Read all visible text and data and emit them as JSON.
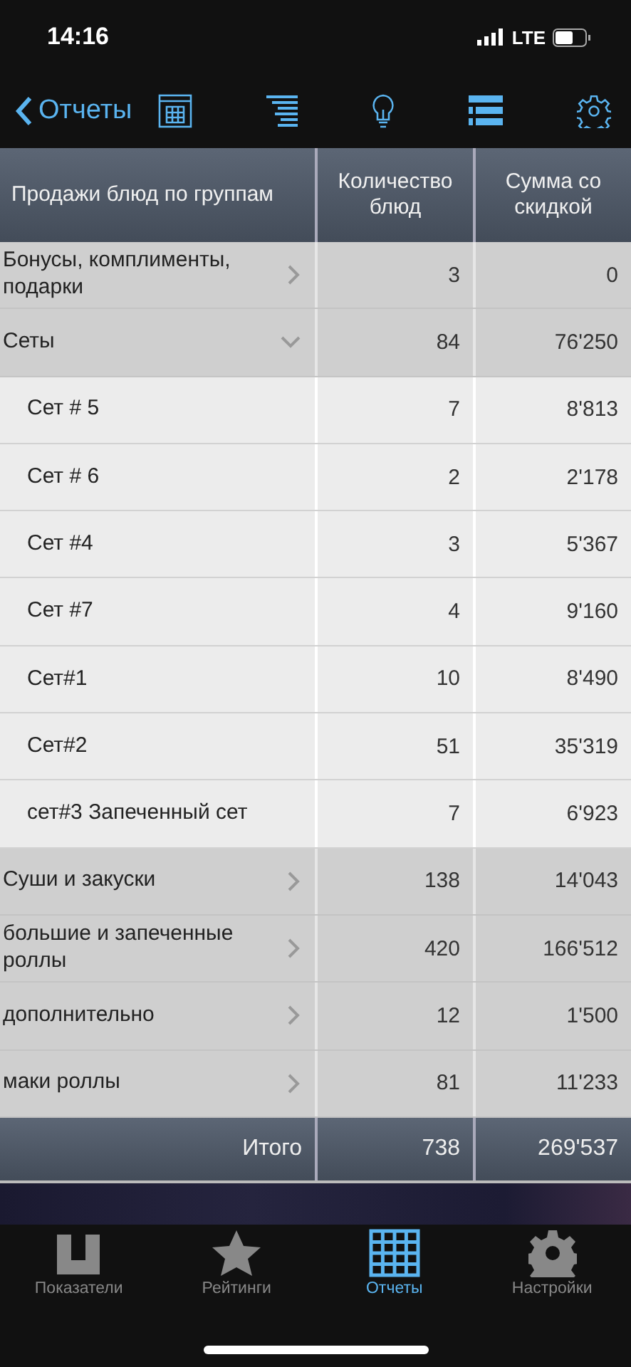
{
  "status_bar": {
    "time": "14:16",
    "network": "LTE"
  },
  "nav": {
    "back_label": "Отчеты"
  },
  "table": {
    "columns": [
      "Продажи блюд по группам",
      "Количество блюд",
      "Сумма со скидкой"
    ],
    "rows": [
      {
        "name": "Бонусы, комплименты, подарки",
        "qty": "3",
        "sum": "0",
        "expanded": false
      },
      {
        "name": "Сеты",
        "qty": "84",
        "sum": "76'250",
        "expanded": true,
        "children": [
          {
            "name": "Сет # 5",
            "qty": "7",
            "sum": "8'813"
          },
          {
            "name": "Сет # 6",
            "qty": "2",
            "sum": "2'178"
          },
          {
            "name": "Сет #4",
            "qty": "3",
            "sum": "5'367"
          },
          {
            "name": "Сет #7",
            "qty": "4",
            "sum": "9'160"
          },
          {
            "name": "Сет#1",
            "qty": "10",
            "sum": "8'490"
          },
          {
            "name": "Сет#2",
            "qty": "51",
            "sum": "35'319"
          },
          {
            "name": "сет#3 Запеченный сет",
            "qty": "7",
            "sum": "6'923"
          }
        ]
      },
      {
        "name": "Суши и закуски",
        "qty": "138",
        "sum": "14'043",
        "expanded": false
      },
      {
        "name": "большие и запеченные роллы",
        "qty": "420",
        "sum": "166'512",
        "expanded": false
      },
      {
        "name": "дополнительно",
        "qty": "12",
        "sum": "1'500",
        "expanded": false
      },
      {
        "name": "маки роллы",
        "qty": "81",
        "sum": "11'233",
        "expanded": false
      }
    ],
    "total": {
      "label": "Итого",
      "qty": "738",
      "sum": "269'537"
    }
  },
  "tab_bar": [
    {
      "label": "Показатели",
      "selected": false
    },
    {
      "label": "Рейтинги",
      "selected": false
    },
    {
      "label": "Отчеты",
      "selected": true
    },
    {
      "label": "Настройки",
      "selected": false
    }
  ]
}
